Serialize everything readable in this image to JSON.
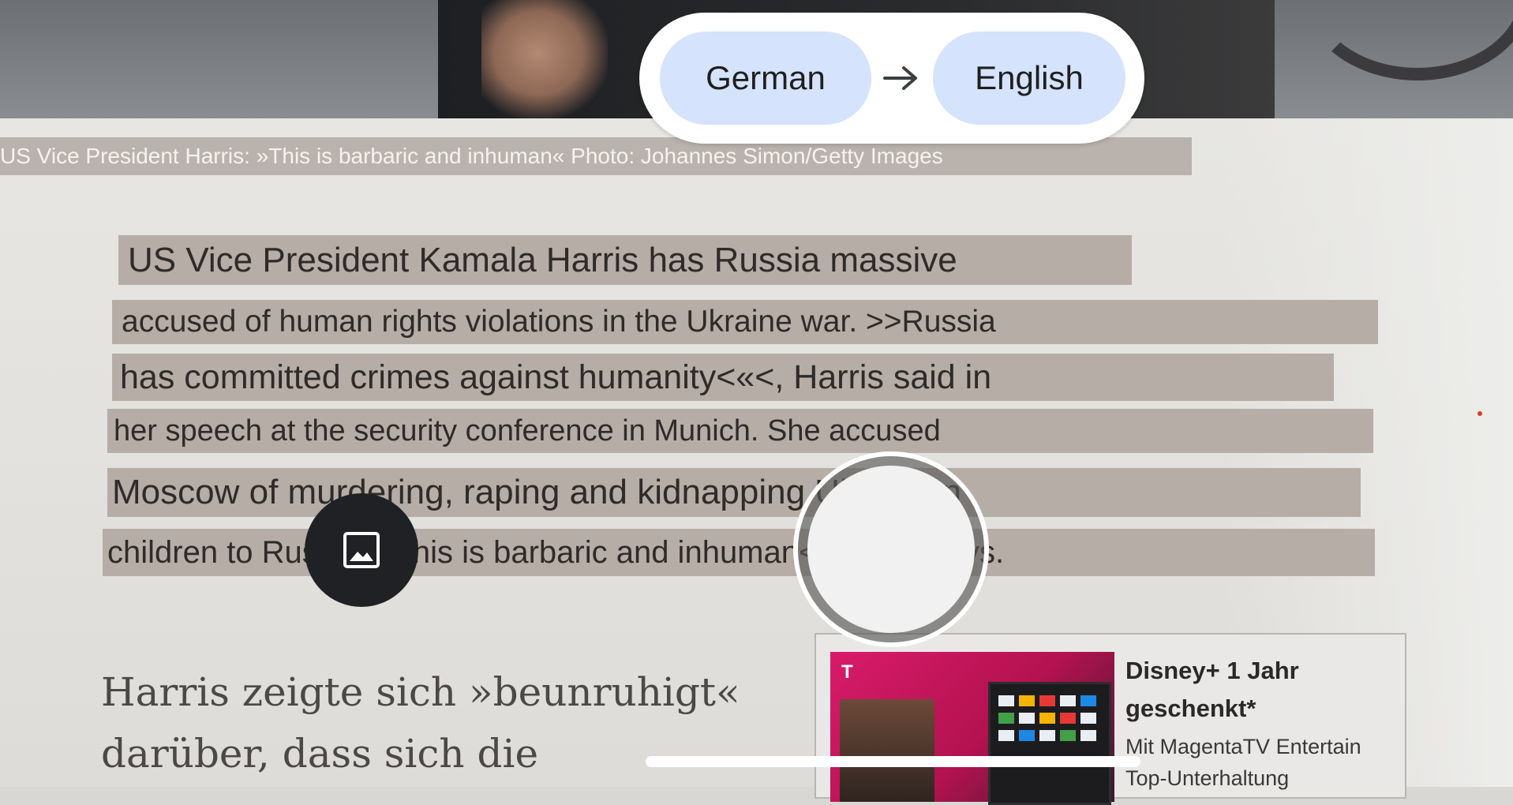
{
  "language_bar": {
    "source_language": "German",
    "target_language": "English",
    "arrow_icon": "arrow-right-icon"
  },
  "translation": {
    "caption": "US Vice President Harris: »This is barbaric and inhuman« Photo: Johannes Simon/Getty Images",
    "lines": [
      "US Vice President Kamala Harris has Russia massive",
      "accused of human rights violations in the Ukraine war. >>Russia",
      "has committed crimes against humanity<«<, Harris said in",
      "her speech at the security conference in Munich. She accused",
      "Moscow of murdering, raping and kidnapping Ukrainian",
      "children to Russia. »This is barbaric and inhuman<«<, she says."
    ]
  },
  "background_text": {
    "line1": "Harris zeigte sich »beunruhigt«",
    "line2": "darüber, dass sich die"
  },
  "ad": {
    "logo": "T",
    "title": "Disney+ 1 Jahr geschenkt*",
    "subtitle_1": "Mit MagentaTV Entertain",
    "subtitle_2": "Top-Unterhaltung"
  },
  "controls": {
    "gallery_icon": "image-gallery-icon",
    "shutter": "shutter-button"
  }
}
